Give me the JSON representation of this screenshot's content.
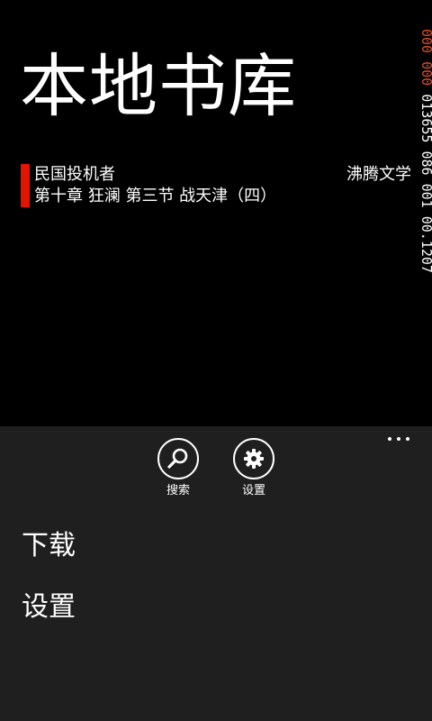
{
  "page": {
    "title": "本地书库"
  },
  "books": [
    {
      "title": "民国投机者",
      "chapter": "第十章 狂澜 第三节 战天津（四）",
      "source": "沸腾文学"
    }
  ],
  "debug_counter": {
    "highlighted": "000 000",
    "rest": " 013655 086 001 00.1207"
  },
  "app_bar": {
    "buttons": [
      {
        "label": "搜索",
        "icon": "search-icon"
      },
      {
        "label": "设置",
        "icon": "gear-icon"
      }
    ],
    "menu_items": [
      "下载",
      "设置"
    ]
  },
  "colors": {
    "accent": "#e51400",
    "app_bar_bg": "#1f1f1f"
  }
}
